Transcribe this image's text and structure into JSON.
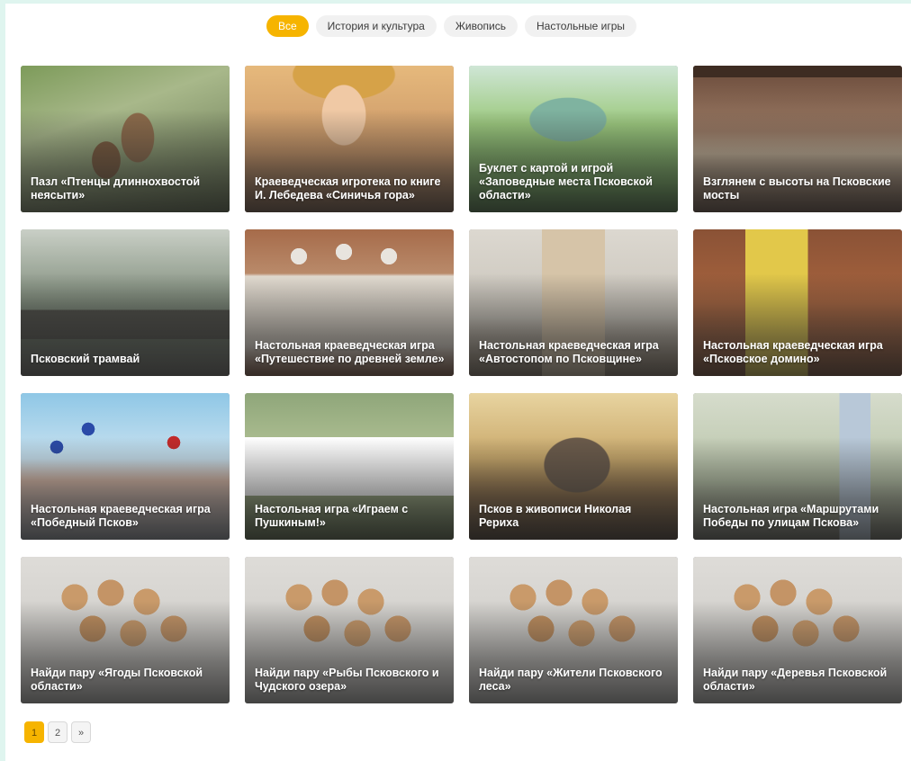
{
  "filters": [
    {
      "label": "Все",
      "active": true
    },
    {
      "label": "История и культура",
      "active": false
    },
    {
      "label": "Живопись",
      "active": false
    },
    {
      "label": "Настольные игры",
      "active": false
    }
  ],
  "cards": [
    {
      "title": "Пазл «Птенцы длиннохвостой неясыти»"
    },
    {
      "title": "Краеведческая игротека по книге И. Лебедева «Синичья гора»"
    },
    {
      "title": "Буклет с картой и игрой «Заповедные места Псковской области»"
    },
    {
      "title": "Взглянем с высоты на Псковские мосты"
    },
    {
      "title": "Псковский трамвай"
    },
    {
      "title": "Настольная краеведческая игра «Путешествие по древней земле»"
    },
    {
      "title": "Настольная краеведческая игра «Автостопом по Псковщине»"
    },
    {
      "title": "Настольная краеведческая игра «Псковское домино»"
    },
    {
      "title": "Настольная краеведческая игра «Победный Псков»"
    },
    {
      "title": "Настольная игра «Играем с Пушкиным!»"
    },
    {
      "title": "Псков в живописи Николая Рериха"
    },
    {
      "title": "Настольная игра «Маршрутами Победы по улицам Пскова»"
    },
    {
      "title": "Найди пару «Ягоды Псковской области»"
    },
    {
      "title": "Найди пару «Рыбы Псковского и Чудского озера»"
    },
    {
      "title": "Найди пару «Жители Псковского леса»"
    },
    {
      "title": "Найди пару «Деревья Псковской области»"
    }
  ],
  "pagination": {
    "pages": [
      "1",
      "2"
    ],
    "current": "1",
    "next": "»"
  },
  "colors": {
    "accent": "#f6b400",
    "chip_bg": "#f1f1f1",
    "page_frame": "#dff5ef"
  }
}
